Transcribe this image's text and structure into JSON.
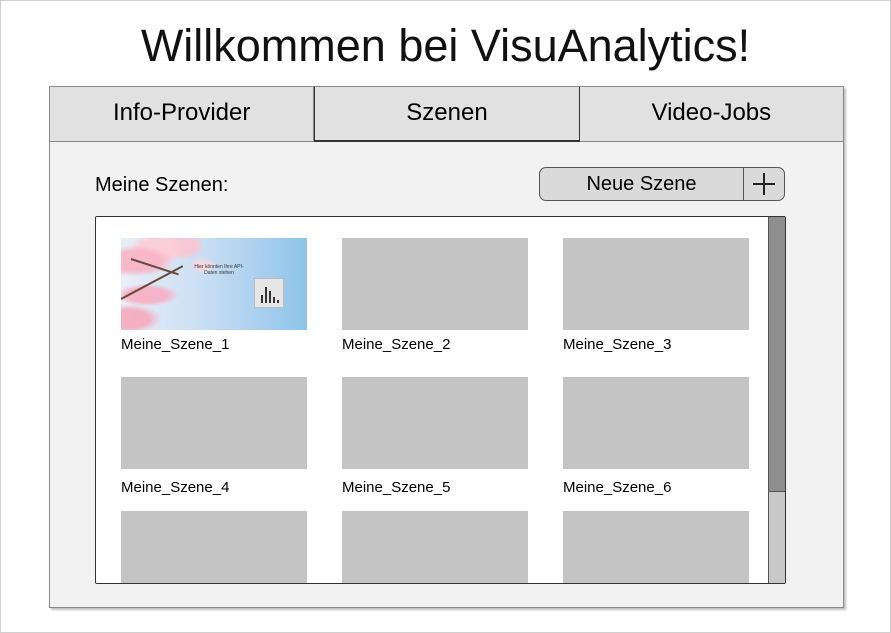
{
  "page": {
    "title": "Willkommen bei VisuAnalytics!"
  },
  "tabs": [
    {
      "label": "Info-Provider",
      "active": false
    },
    {
      "label": "Szenen",
      "active": true
    },
    {
      "label": "Video-Jobs",
      "active": false
    }
  ],
  "scenes_section": {
    "label": "Meine Szenen:",
    "new_scene_button": {
      "label": "Neue Szene",
      "icon": "plus-icon"
    }
  },
  "scenes": [
    {
      "name": "Meine_Szene_1",
      "thumbnail_text": "Hier könnten Ihre API-Daten stehen"
    },
    {
      "name": "Meine_Szene_2"
    },
    {
      "name": "Meine_Szene_3"
    },
    {
      "name": "Meine_Szene_4"
    },
    {
      "name": "Meine_Szene_5"
    },
    {
      "name": "Meine_Szene_6"
    },
    {
      "name": ""
    },
    {
      "name": ""
    },
    {
      "name": ""
    }
  ],
  "colors": {
    "placeholder": "#c4c4c4",
    "tab_bg": "#e1e1e1",
    "panel_bg": "#f2f2f2"
  }
}
